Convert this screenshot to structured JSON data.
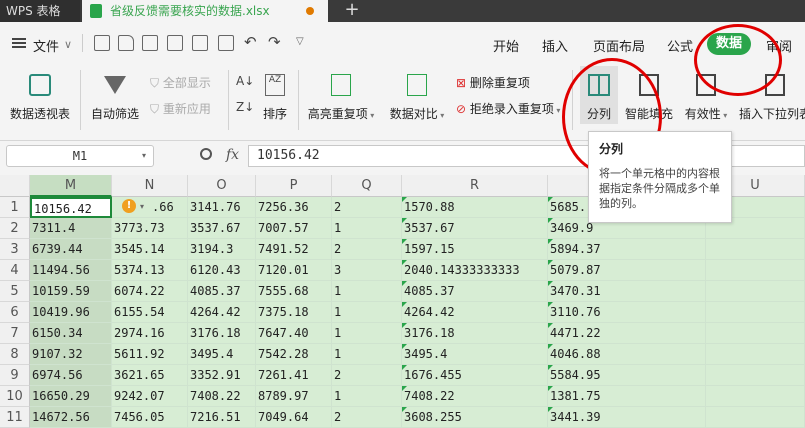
{
  "title_bar": {
    "app_tab": "WPS 表格",
    "file_tab": "省级反馈需要核实的数据.xlsx",
    "new_tab": "+"
  },
  "menu": {
    "file_label": "文件",
    "file_arrow": "∨",
    "tabs": [
      "开始",
      "插入",
      "页面布局",
      "公式",
      "数据",
      "审阅"
    ],
    "active_tab": "数据"
  },
  "ribbon": {
    "pivot": "数据透视表",
    "autofilter": "自动筛选",
    "show_all": "全部显示",
    "reapply": "重新应用",
    "sort": "排序",
    "highlight_dup": "高亮重复项",
    "compare": "数据对比",
    "remove_dup": "删除重复项",
    "reject_dup": "拒绝录入重复项",
    "split": "分列",
    "smart_fill": "智能填充",
    "validity": "有效性",
    "insert_dropdown": "插入下拉列表"
  },
  "tooltip": {
    "title": "分列",
    "body": "将一个单元格中的内容根据指定条件分隔成多个单独的列。"
  },
  "formula_bar": {
    "name_box": "M1",
    "fx": "fx",
    "value": "10156.42"
  },
  "grid": {
    "columns": [
      "M",
      "N",
      "O",
      "P",
      "Q",
      "R",
      "",
      "U"
    ],
    "rows": [
      {
        "n": "1",
        "M": "10156.42",
        "N": ".66",
        "O": "3141.76",
        "P": "7256.36",
        "Q": "2",
        "R": "1570.88",
        "S": "5685."
      },
      {
        "n": "2",
        "M": "7311.4",
        "N": "3773.73",
        "O": "3537.67",
        "P": "7007.57",
        "Q": "1",
        "R": "3537.67",
        "S": "3469.9"
      },
      {
        "n": "3",
        "M": "6739.44",
        "N": "3545.14",
        "O": "3194.3",
        "P": "7491.52",
        "Q": "2",
        "R": "1597.15",
        "S": "5894.37"
      },
      {
        "n": "4",
        "M": "11494.56",
        "N": "5374.13",
        "O": "6120.43",
        "P": "7120.01",
        "Q": "3",
        "R": "2040.14333333333",
        "S": "5079.87"
      },
      {
        "n": "5",
        "M": "10159.59",
        "N": "6074.22",
        "O": "4085.37",
        "P": "7555.68",
        "Q": "1",
        "R": "4085.37",
        "S": "3470.31"
      },
      {
        "n": "6",
        "M": "10419.96",
        "N": "6155.54",
        "O": "4264.42",
        "P": "7375.18",
        "Q": "1",
        "R": "4264.42",
        "S": "3110.76"
      },
      {
        "n": "7",
        "M": "6150.34",
        "N": "2974.16",
        "O": "3176.18",
        "P": "7647.40",
        "Q": "1",
        "R": "3176.18",
        "S": "4471.22"
      },
      {
        "n": "8",
        "M": "9107.32",
        "N": "5611.92",
        "O": "3495.4",
        "P": "7542.28",
        "Q": "1",
        "R": "3495.4",
        "S": "4046.88"
      },
      {
        "n": "9",
        "M": "6974.56",
        "N": "3621.65",
        "O": "3352.91",
        "P": "7261.41",
        "Q": "2",
        "R": "1676.455",
        "S": "5584.95"
      },
      {
        "n": "10",
        "M": "16650.29",
        "N": "9242.07",
        "O": "7408.22",
        "P": "8789.97",
        "Q": "1",
        "R": "7408.22",
        "S": "1381.75"
      },
      {
        "n": "11",
        "M": "14672.56",
        "N": "7456.05",
        "O": "7216.51",
        "P": "7049.64",
        "Q": "2",
        "R": "3608.255",
        "S": "3441.39"
      }
    ]
  },
  "colors": {
    "accent": "#2aa54b",
    "cell_fill": "#d7edd4",
    "annotation": "#e00000"
  }
}
